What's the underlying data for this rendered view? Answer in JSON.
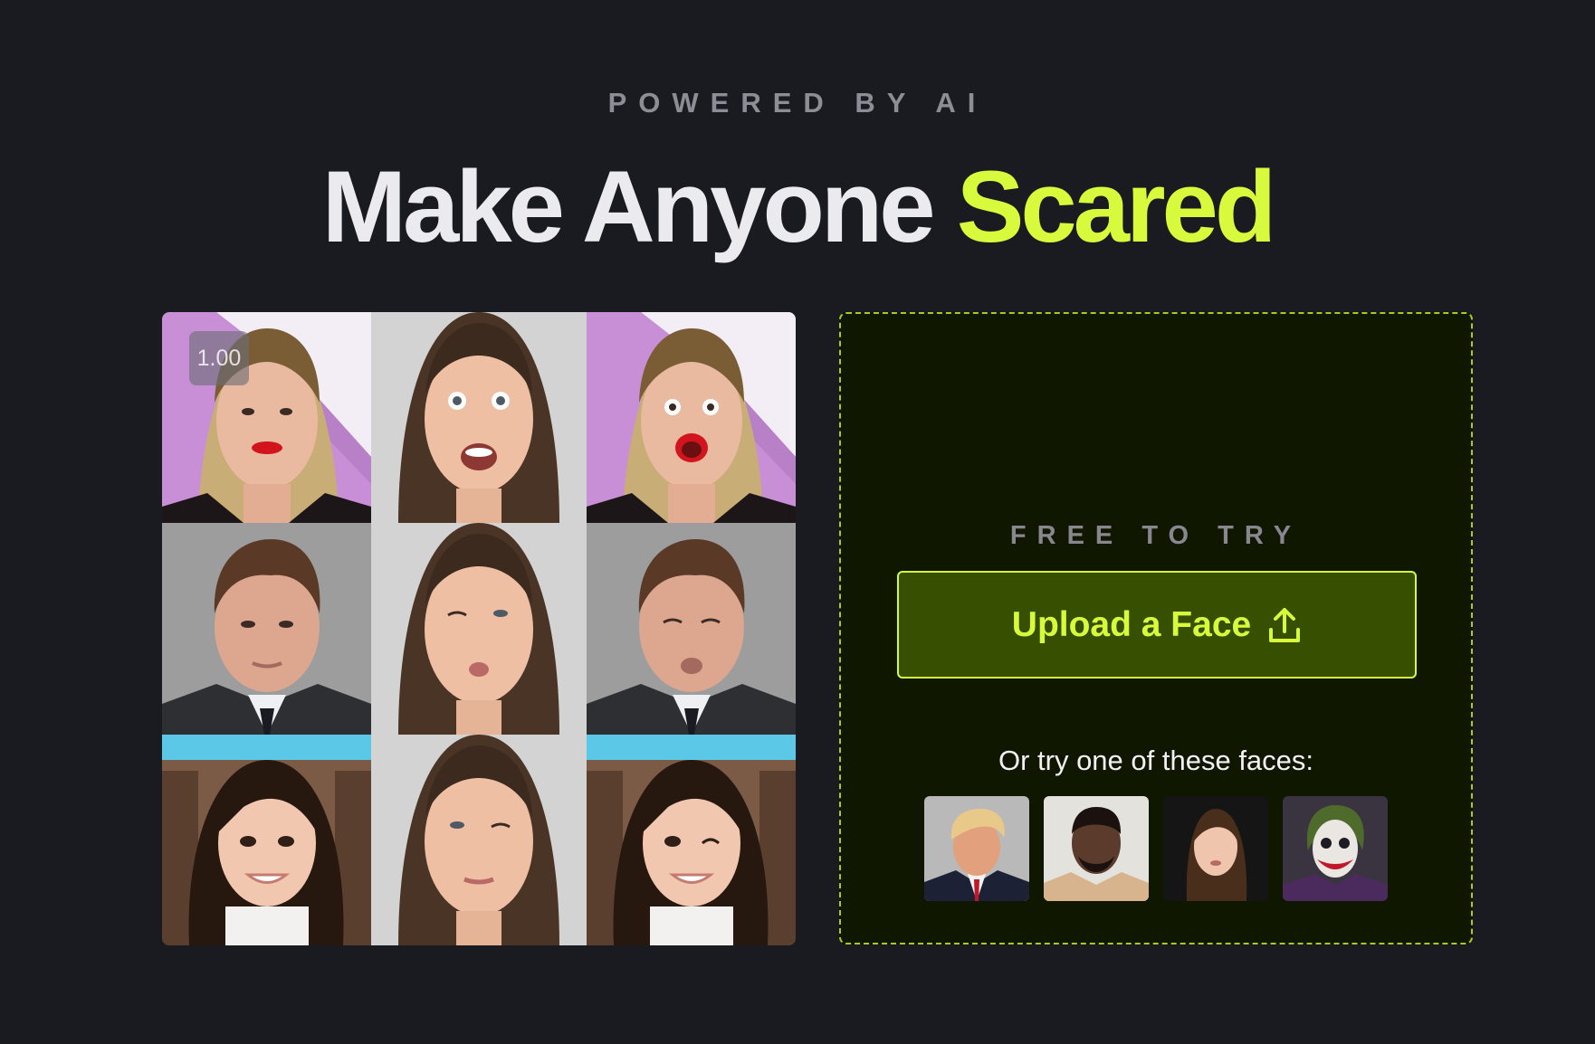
{
  "hero": {
    "eyebrow": "POWERED BY AI",
    "headline_plain": "Make Anyone ",
    "headline_accent": "Scared",
    "accent_color": "#d8fa3c"
  },
  "demo": {
    "speed_badge": "1.00",
    "rows": [
      [
        "source-face-blonde-woman",
        "driving-expression-surprised",
        "result-blonde-woman-surprised"
      ],
      [
        "source-face-man-in-suit",
        "driving-expression-wink-pucker",
        "result-man-wink-pucker"
      ],
      [
        "source-face-smiling-girl",
        "driving-expression-wink",
        "result-smiling-girl-wink"
      ]
    ]
  },
  "upload": {
    "free_label": "FREE TO TRY",
    "button_label": "Upload a Face",
    "button_icon": "upload-icon",
    "or_try": "Or try one of these faces:",
    "samples": [
      {
        "name": "sample-face-1",
        "background": "#b9b9b9"
      },
      {
        "name": "sample-face-2",
        "background": "#e4e2dd"
      },
      {
        "name": "sample-face-3",
        "background": "#151515"
      },
      {
        "name": "sample-face-4",
        "background": "#3a3440"
      }
    ]
  }
}
